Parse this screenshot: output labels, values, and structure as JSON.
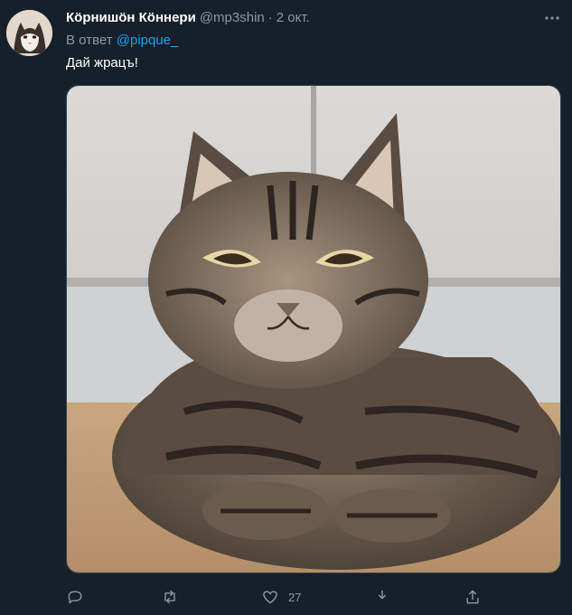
{
  "tweet": {
    "author_name": "Кӧрнишӧн Кӧннери",
    "author_handle": "@mp3shin",
    "separator": "·",
    "time": "2 окт.",
    "reply_prefix": "В ответ",
    "reply_mention": "@pipque_",
    "text": "Дай жрацъ!",
    "likes": "27"
  },
  "icons": {
    "more": "more-horizontal-icon",
    "reply": "reply-icon",
    "retweet": "retweet-icon",
    "like": "like-icon",
    "share": "share-icon",
    "upload": "upload-icon"
  },
  "colors": {
    "background": "#15202b",
    "secondary_text": "#8899a6",
    "link": "#1da1f2"
  }
}
